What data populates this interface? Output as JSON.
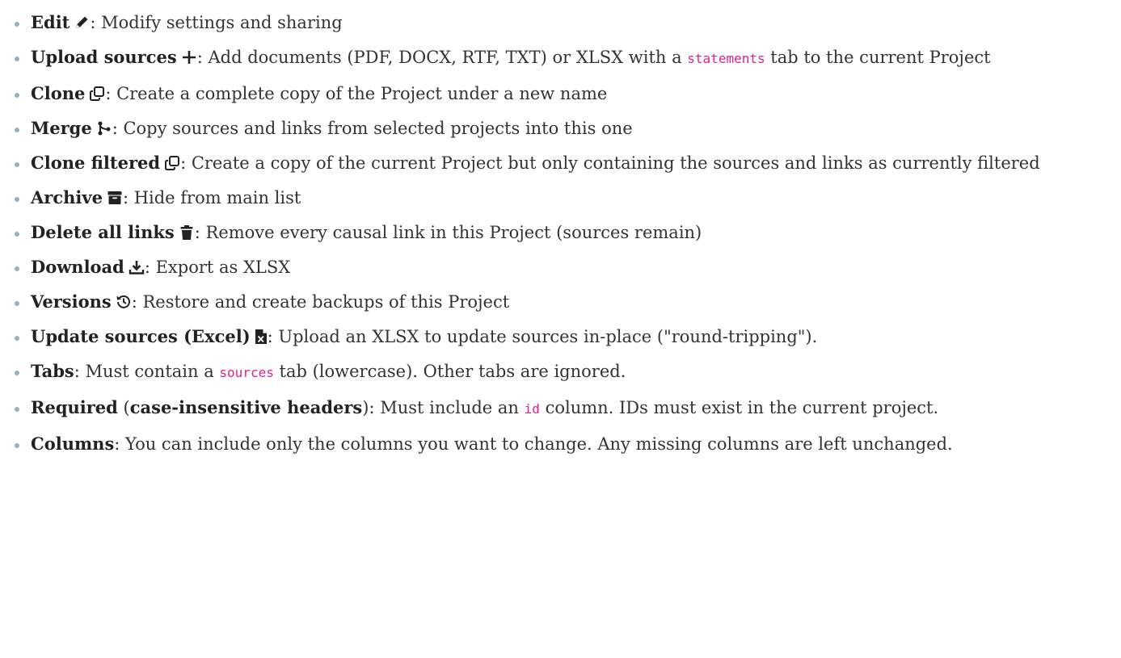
{
  "items": [
    {
      "title": "Edit",
      "icon": "pencil-icon",
      "desc": ": Modify settings and sharing"
    },
    {
      "title": "Upload sources",
      "icon": "plus-icon",
      "desc_a": ": Add documents (PDF, DOCX, RTF, TXT) or XLSX with a ",
      "code": "statements",
      "desc_b": " tab to the current Project"
    },
    {
      "title": "Clone",
      "icon": "copy-icon",
      "desc": ": Create a complete copy of the Project under a new name"
    },
    {
      "title": "Merge",
      "icon": "merge-icon",
      "desc": ": Copy sources and links from selected projects into this one"
    },
    {
      "title": "Clone filtered",
      "icon": "copy-icon",
      "desc": ": Create a copy of the current Project but only containing the sources and links as currently filtered"
    },
    {
      "title": "Archive",
      "icon": "archive-icon",
      "desc": ": Hide from main list"
    },
    {
      "title": "Delete all links",
      "icon": "trash-icon",
      "desc": ": Remove every causal link in this Project (sources remain)"
    },
    {
      "title": "Download",
      "icon": "download-icon",
      "desc": ": Export as XLSX"
    },
    {
      "title": "Versions",
      "icon": "history-icon",
      "desc": ": Restore and create backups of this Project"
    },
    {
      "title": "Update sources (Excel)",
      "icon": "excel-file-icon",
      "desc": ": Upload an XLSX to update sources in-place (\"round-tripping\")."
    },
    {
      "title": "Tabs",
      "desc_a": ": Must contain a ",
      "code": "sources",
      "desc_b": " tab (lowercase). Other tabs are ignored."
    },
    {
      "title": "Required",
      "paren_open": " (",
      "title2": "case-insensitive headers",
      "paren_close": ")",
      "desc_a": ": Must include an ",
      "code": "id",
      "desc_b": " column. IDs must exist in the current project."
    },
    {
      "title": "Columns",
      "desc": ": You can include only the columns you want to change. Any missing columns are left unchanged."
    }
  ],
  "colors": {
    "text": "#333333",
    "bullet": "#8fb4ca",
    "code": "#e0218a"
  }
}
